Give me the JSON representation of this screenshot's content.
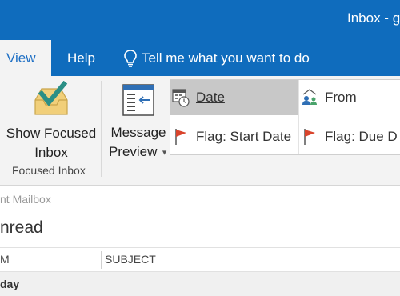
{
  "window": {
    "title": "Inbox - g"
  },
  "tabs": {
    "view": "View",
    "help": "Help",
    "tell_me": "Tell me what you want to do"
  },
  "ribbon": {
    "show_focused": {
      "line1": "Show Focused",
      "line2": "Inbox"
    },
    "group_focused_label": "Focused Inbox",
    "message_preview": {
      "line1": "Message",
      "line2": "Preview"
    },
    "arrangement": {
      "date": "Date",
      "from": "From",
      "flag_start": "Flag: Start Date",
      "flag_due": "Flag: Due D"
    }
  },
  "mailbox": {
    "label": "nt Mailbox"
  },
  "filter": {
    "label": "nread"
  },
  "columns": {
    "from": "M",
    "subject": "SUBJECT"
  },
  "group_header": {
    "label": "day"
  },
  "colors": {
    "brand": "#0f6cbd",
    "flag": "#d9442c"
  }
}
